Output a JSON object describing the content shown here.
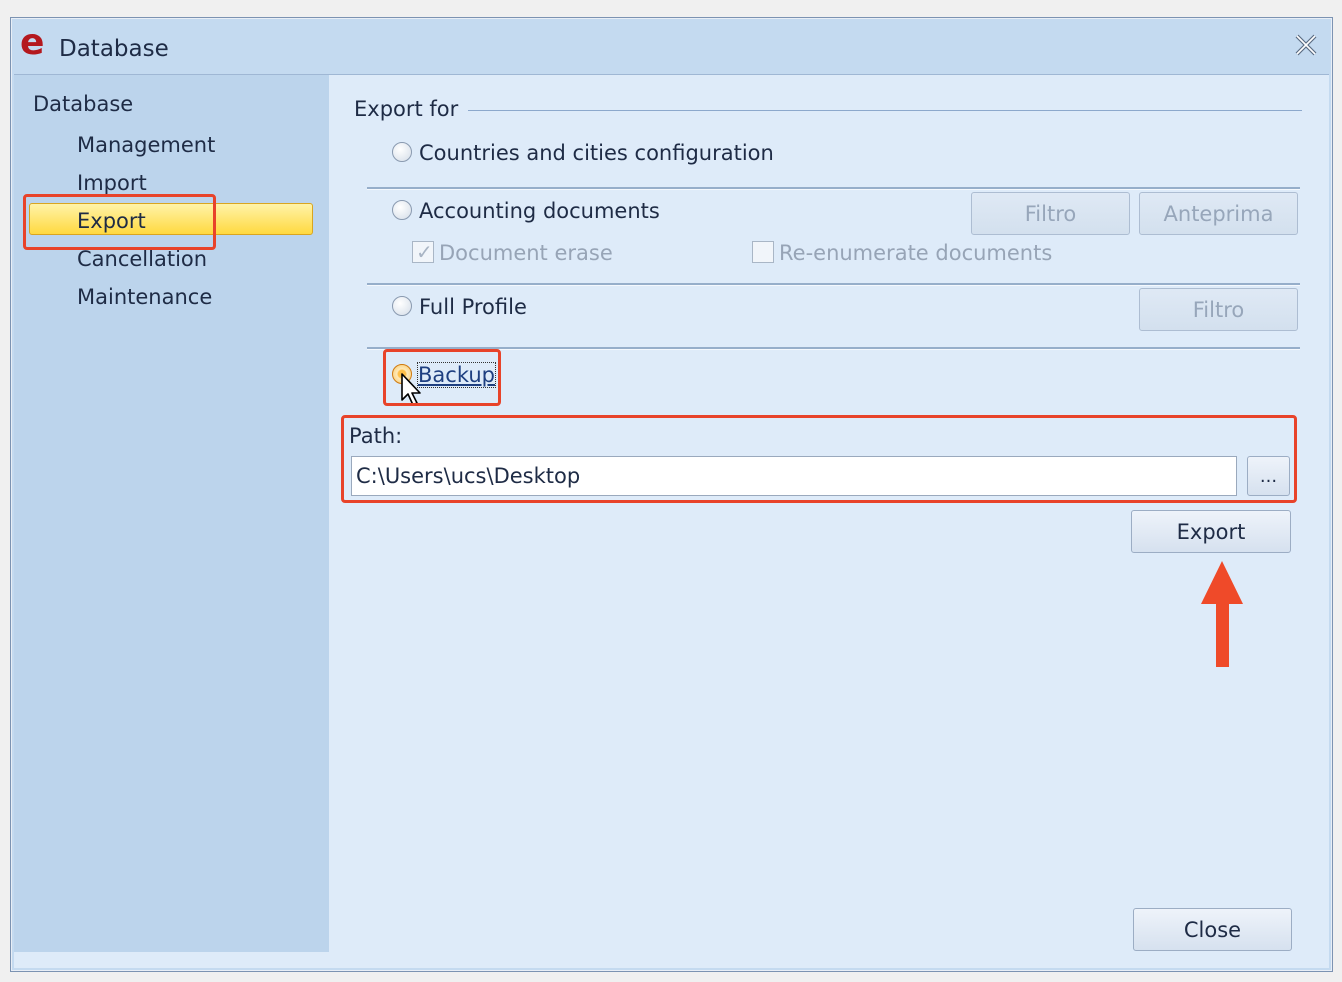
{
  "window": {
    "title": "Database",
    "app_icon": "e"
  },
  "sidebar": {
    "root": "Database",
    "items": [
      {
        "label": "Management"
      },
      {
        "label": "Import"
      },
      {
        "label": "Export",
        "selected": true
      },
      {
        "label": "Cancellation"
      },
      {
        "label": "Maintenance"
      }
    ]
  },
  "export": {
    "group_label": "Export for",
    "options": {
      "countries": "Countries and cities configuration",
      "accounting": "Accounting documents",
      "full_profile": "Full Profile",
      "backup": "Backup"
    },
    "selected_option": "Backup",
    "document_erase": "Document erase",
    "document_erase_checked": true,
    "reenumerate": "Re-enumerate documents",
    "reenumerate_checked": false,
    "filtro_label": "Filtro",
    "anteprima_label": "Anteprima",
    "profile_filtro_label": "Filtro"
  },
  "path": {
    "label": "Path:",
    "value": "C:\\Users\\ucs\\Desktop",
    "browse_label": "..."
  },
  "buttons": {
    "export": "Export",
    "close": "Close"
  },
  "colors": {
    "highlight": "#e8432a",
    "selection": "#ffd940",
    "sidebar": "#bcd4ec",
    "panel": "#deebf9"
  },
  "icons": {
    "close": "close-icon",
    "cursor": "mouse-pointer-icon",
    "annotation": "arrow-up-icon"
  }
}
